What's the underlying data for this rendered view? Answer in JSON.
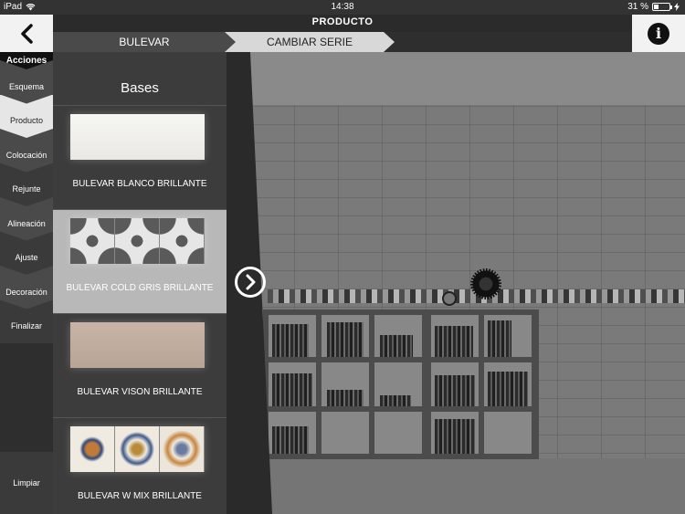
{
  "status_bar": {
    "device": "iPad",
    "time": "14:38",
    "battery_text": "31 %",
    "battery_level": 0.31
  },
  "header": {
    "title": "PRODUCTO",
    "breadcrumb": [
      "BULEVAR",
      "CAMBIAR SERIE"
    ]
  },
  "sidebar": {
    "title": "Acciones",
    "items": [
      {
        "label": "Esquema"
      },
      {
        "label": "Producto"
      },
      {
        "label": "Colocación"
      },
      {
        "label": "Rejunte"
      },
      {
        "label": "Alineación"
      },
      {
        "label": "Ajuste"
      },
      {
        "label": "Decoración"
      },
      {
        "label": "Finalizar"
      }
    ],
    "active_index": 1,
    "clear_label": "Limpiar"
  },
  "panel": {
    "title": "Bases",
    "tiles": [
      {
        "name": "BULEVAR BLANCO BRILLANTE",
        "selected": false
      },
      {
        "name": "BULEVAR COLD GRIS BRILLANTE",
        "selected": true
      },
      {
        "name": "BULEVAR VISON BRILLANTE",
        "selected": false
      },
      {
        "name": "BULEVAR W MIX BRILLANTE",
        "selected": false
      }
    ]
  },
  "icons": {
    "back": "chevron-left-icon",
    "info": "info-icon",
    "next": "chevron-right-circle-icon",
    "wifi": "wifi-icon",
    "battery": "battery-icon",
    "charging": "bolt-icon"
  },
  "colors": {
    "accent_active": "#e6e6e6",
    "panel_bg": "#3c3c3c",
    "selected_tile_bg": "#b8b8b8"
  }
}
